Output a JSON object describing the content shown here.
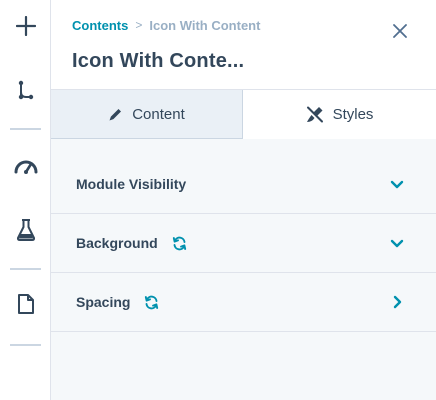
{
  "breadcrumb": {
    "root": "Contents",
    "separator": ">",
    "current": "Icon With Content"
  },
  "panel": {
    "title": "Icon With Conte..."
  },
  "tabs": [
    {
      "label": "Content",
      "icon": "pencil-icon",
      "selected": false
    },
    {
      "label": "Styles",
      "icon": "brush-icon",
      "selected": true
    }
  ],
  "sections": [
    {
      "label": "Module Visibility",
      "synced": false,
      "state": "collapsed",
      "chevron": "chevron-down-icon"
    },
    {
      "label": "Background",
      "synced": true,
      "state": "collapsed",
      "chevron": "chevron-down-icon"
    },
    {
      "label": "Spacing",
      "synced": true,
      "state": "collapsed",
      "chevron": "chevron-right-icon"
    }
  ],
  "rail": {
    "items": [
      "add-icon",
      "tree-icon",
      "gauge-icon",
      "flask-icon",
      "page-icon"
    ]
  },
  "colors": {
    "accent": "#0091ae",
    "text": "#33475b",
    "muted": "#99afc4",
    "panel_bg": "#f5f8fa",
    "tab_inactive_bg": "#eaf0f6",
    "border": "#dfe3eb"
  }
}
